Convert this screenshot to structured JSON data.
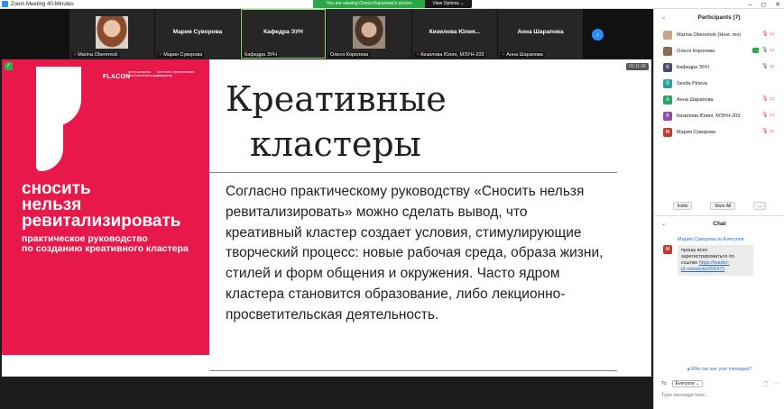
{
  "window": {
    "title": "Zoom Meeting 40-Minutes",
    "viewing_banner": "You are viewing Олеся Королева's screen",
    "view_options": "View Options ⌄"
  },
  "strip": {
    "tiles": [
      {
        "name": "",
        "label": "Marina Oberemok",
        "has_photo": true
      },
      {
        "name": "Мария Суворова",
        "label": "Мария Суворова",
        "has_photo": false
      },
      {
        "name": "Кафедра ЭУН",
        "label": "Кафедра ЭУН",
        "has_photo": false
      },
      {
        "name": "",
        "label": "Олеся Королева",
        "has_photo": true
      },
      {
        "name": "Кизилова  Юлия...",
        "label": "Кизилова Юлия, МЭУН-203",
        "has_photo": false
      },
      {
        "name": "Анна Шарапова",
        "label": "Анна Шарапова",
        "has_photo": false
      }
    ]
  },
  "slide": {
    "brand": "FLACON",
    "brand2": "центр развития креативной экономики",
    "brand3": "Агентство стратегических инициатив",
    "red_title": "сносить нельзя ревитализировать",
    "red_title_lines": [
      "сносить",
      "нельзя",
      "ревитализировать"
    ],
    "red_sub_lines": [
      "практическое руководство",
      "по созданию креативного кластера"
    ],
    "title_line1": "Креативные",
    "title_line2": "кластеры",
    "body": "Согласно практическому руководству «Сносить нельзя ревитализировать» можно сделать вывод, что креативный кластер создает условия, стимулирующие творческий процесс: новые рабочая среда, образа жизни, стилей и форм общения и окружения. Часто ядром кластера становится образование, либо лекционно-просветительская деятельность.",
    "timer": "00:11:36",
    "accent_color": "#e8194a"
  },
  "participants": {
    "header": "Participants (7)",
    "list": [
      {
        "name": "Marina Oberemok (Host, me)",
        "initial": "",
        "color": "#c9a48a",
        "photo": true
      },
      {
        "name": "Олеся Королева",
        "initial": "",
        "color": "#8b6a55",
        "photo": true
      },
      {
        "name": "Кафедра ЭУН",
        "initial": "К",
        "color": "#4a4a6a",
        "photo": false
      },
      {
        "name": "Sevda Pirieva",
        "initial": "S",
        "color": "#2ba0a0",
        "photo": false
      },
      {
        "name": "Анна Шарапова",
        "initial": "А",
        "color": "#2aa36b",
        "photo": false
      },
      {
        "name": "Кизилова Юлия, МЭУН-203",
        "initial": "К",
        "color": "#8a4ab0",
        "photo": false
      },
      {
        "name": "Мария Суворова",
        "initial": "М",
        "color": "#c0392b",
        "photo": false
      }
    ],
    "invite_label": "Invite",
    "mute_all_label": "Mute All",
    "more_label": "..."
  },
  "chat": {
    "header": "Chat",
    "message_meta": "Мария Суворова to Everyone",
    "message_initial": "M",
    "message_text": "прошу всех зарегистрироваться по ссылке",
    "message_link": "https://leader-id.ru/events/255471",
    "who_can_see": "Who can see your messages?",
    "to_label": "To:",
    "to_value": "Everyone ⌄",
    "input_placeholder": "Type message here..."
  }
}
